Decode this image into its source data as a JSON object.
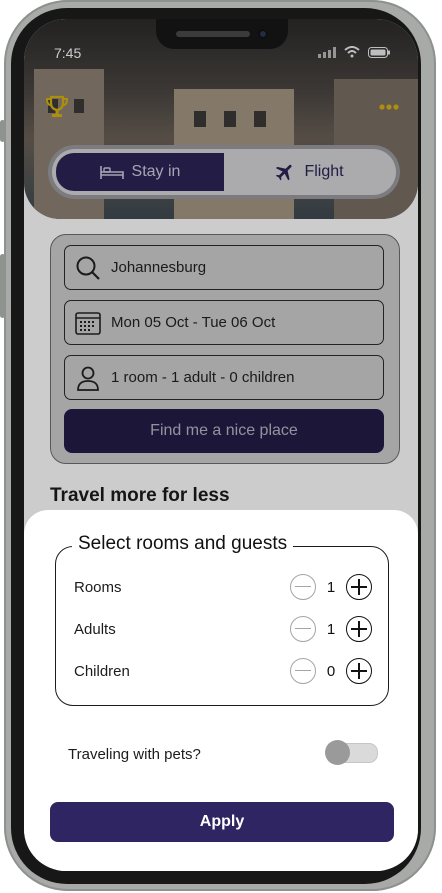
{
  "status_bar": {
    "time": "7:45"
  },
  "header": {
    "trophy_icon": "trophy-icon",
    "more_icon": "more-dots-icon",
    "accent_color": "#d8b312"
  },
  "tabs": {
    "stay_label": "Stay in",
    "flight_label": "Flight",
    "active": "Stay in"
  },
  "search": {
    "destination": "Johannesburg",
    "dates": "Mon 05 Oct - Tue 06 Oct",
    "guests": "1 room - 1 adult - 0 children",
    "find_label": "Find me a nice place"
  },
  "section_title": "Travel more for less",
  "sheet": {
    "title": "Select rooms and guests",
    "rows": [
      {
        "label": "Rooms",
        "count": "1"
      },
      {
        "label": "Adults",
        "count": "1"
      },
      {
        "label": "Children",
        "count": "0"
      }
    ],
    "pets_label": "Traveling with pets?",
    "pets_enabled": false,
    "apply_label": "Apply",
    "apply_color": "#2f2563"
  }
}
